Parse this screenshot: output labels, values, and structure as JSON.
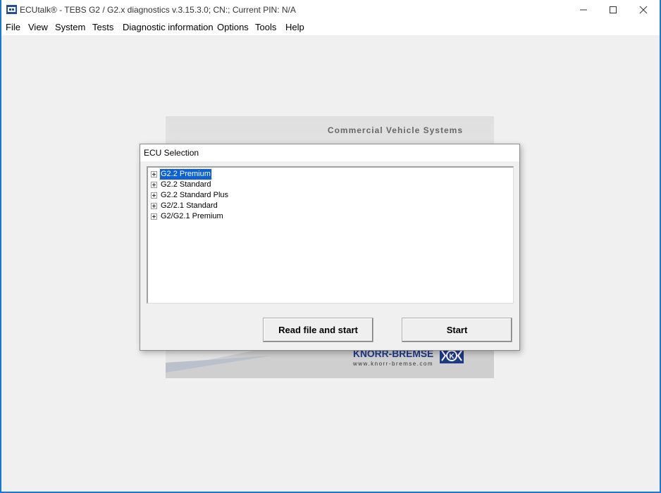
{
  "window": {
    "title": "ECUtalk® - TEBS G2 / G2.x diagnostics v.3.15.3.0; CN:; Current PIN: N/A",
    "minimize_glyph": "—",
    "maximize_glyph": "☐",
    "close_glyph": "✕"
  },
  "menu": [
    {
      "label": "File"
    },
    {
      "label": "View"
    },
    {
      "label": "System"
    },
    {
      "label": "Tests"
    },
    {
      "label": "Diagnostic information"
    },
    {
      "label": "Options"
    },
    {
      "label": "Tools"
    },
    {
      "label": "Help"
    }
  ],
  "splash": {
    "caption": "Commercial Vehicle Systems",
    "brand_name": "KNORR-BREMSE",
    "brand_url": "www.knorr-bremse.com",
    "brand_color": "#1d3a8a"
  },
  "dialog": {
    "title": "ECU Selection",
    "tree_items": [
      {
        "label": "G2.2 Premium",
        "selected": true
      },
      {
        "label": "G2.2 Standard",
        "selected": false
      },
      {
        "label": "G2.2 Standard Plus",
        "selected": false
      },
      {
        "label": "G2/2.1 Standard",
        "selected": false
      },
      {
        "label": "G2/G2.1 Premium",
        "selected": false
      }
    ],
    "read_file_button": "Read file and start",
    "start_button": "Start",
    "selection_color": "#0a62d6"
  },
  "colors": {
    "desktop": "#1b78d0",
    "window_bg": "#f0f0f0"
  }
}
